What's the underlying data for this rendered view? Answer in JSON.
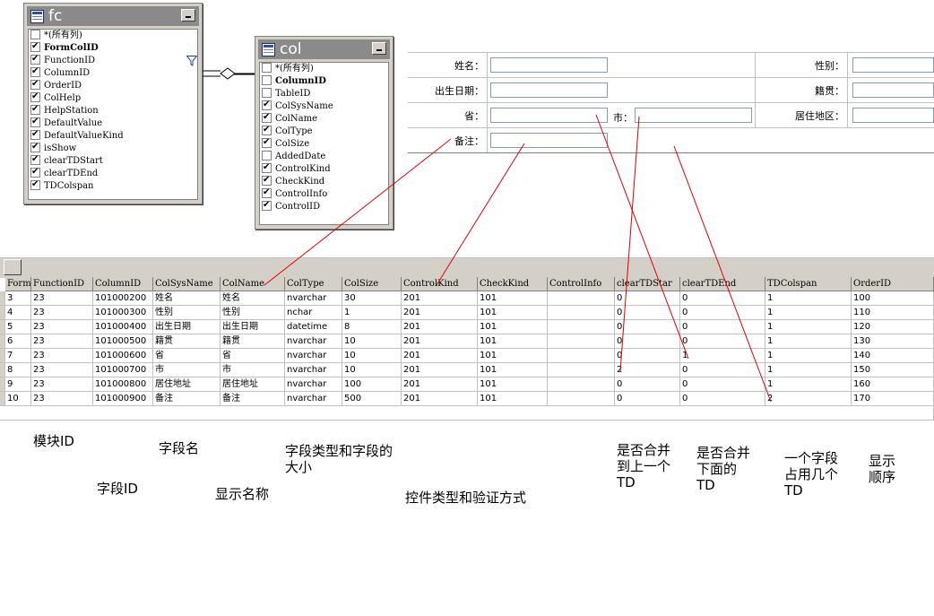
{
  "fc_window": {
    "title": "fc",
    "fields": [
      {
        "label": "*(所有列)",
        "checked": false,
        "bold": false
      },
      {
        "label": "FormColID",
        "checked": true,
        "bold": true
      },
      {
        "label": "FunctionID",
        "checked": true,
        "bold": false
      },
      {
        "label": "ColumnID",
        "checked": true,
        "bold": false
      },
      {
        "label": "OrderID",
        "checked": true,
        "bold": false
      },
      {
        "label": "ColHelp",
        "checked": true,
        "bold": false
      },
      {
        "label": "HelpStation",
        "checked": true,
        "bold": false
      },
      {
        "label": "DefaultValue",
        "checked": true,
        "bold": false
      },
      {
        "label": "DefaultValueKind",
        "checked": true,
        "bold": false
      },
      {
        "label": "isShow",
        "checked": true,
        "bold": false
      },
      {
        "label": "clearTDStart",
        "checked": true,
        "bold": false
      },
      {
        "label": "clearTDEnd",
        "checked": true,
        "bold": false
      },
      {
        "label": "TDColspan",
        "checked": true,
        "bold": false
      }
    ]
  },
  "col_window": {
    "title": "col",
    "fields": [
      {
        "label": "*(所有列)",
        "checked": false,
        "bold": false
      },
      {
        "label": "ColumnID",
        "checked": false,
        "bold": true
      },
      {
        "label": "TableID",
        "checked": false,
        "bold": false
      },
      {
        "label": "ColSysName",
        "checked": true,
        "bold": false
      },
      {
        "label": "ColName",
        "checked": true,
        "bold": false
      },
      {
        "label": "ColType",
        "checked": true,
        "bold": false
      },
      {
        "label": "ColSize",
        "checked": true,
        "bold": false
      },
      {
        "label": "AddedDate",
        "checked": false,
        "bold": false
      },
      {
        "label": "ControlKind",
        "checked": true,
        "bold": false
      },
      {
        "label": "CheckKind",
        "checked": true,
        "bold": false
      },
      {
        "label": "ControlInfo",
        "checked": true,
        "bold": false
      },
      {
        "label": "ControlID",
        "checked": true,
        "bold": false
      }
    ]
  },
  "form": {
    "name_label": "姓名：",
    "gender_label": "性别：",
    "birth_label": "出生日期：",
    "origin_label": "籍贯：",
    "province_label": "省：",
    "city_label": "市：",
    "address_label": "居住地区：",
    "note_label": "备注："
  },
  "grid": {
    "columns": [
      "Form",
      "FunctionID",
      "ColumnID",
      "ColSysName",
      "ColName",
      "ColType",
      "ColSize",
      "ControlKind",
      "CheckKind",
      "ControlInfo",
      "clearTDStar",
      "clearTDEnd",
      "TDColspan",
      "OrderID"
    ],
    "rows": [
      [
        "3",
        "23",
        "101000200",
        "姓名",
        "姓名",
        "nvarchar",
        "30",
        "201",
        "101",
        "",
        "0",
        "0",
        "1",
        "100"
      ],
      [
        "4",
        "23",
        "101000300",
        "性别",
        "性别",
        "nchar",
        "1",
        "201",
        "101",
        "",
        "0",
        "0",
        "1",
        "110"
      ],
      [
        "5",
        "23",
        "101000400",
        "出生日期",
        "出生日期",
        "datetime",
        "8",
        "201",
        "101",
        "",
        "0",
        "0",
        "1",
        "120"
      ],
      [
        "6",
        "23",
        "101000500",
        "籍贯",
        "籍贯",
        "nvarchar",
        "10",
        "201",
        "101",
        "",
        "0",
        "0",
        "1",
        "130"
      ],
      [
        "7",
        "23",
        "101000600",
        "省",
        "省",
        "nvarchar",
        "10",
        "201",
        "101",
        "",
        "0",
        "1",
        "1",
        "140"
      ],
      [
        "8",
        "23",
        "101000700",
        "市",
        "市",
        "nvarchar",
        "10",
        "201",
        "101",
        "",
        "2",
        "0",
        "1",
        "150"
      ],
      [
        "9",
        "23",
        "101000800",
        "居住地址",
        "居住地址",
        "nvarchar",
        "100",
        "201",
        "101",
        "",
        "0",
        "0",
        "1",
        "160"
      ],
      [
        "10",
        "23",
        "101000900",
        "备注",
        "备注",
        "nvarchar",
        "500",
        "201",
        "101",
        "",
        "0",
        "0",
        "2",
        "170"
      ]
    ]
  },
  "annotations": {
    "module_id": "模块ID",
    "field_name": "字段名",
    "field_type": "字段类型和字段的大小",
    "field_id": "字段ID",
    "display_name": "显示名称",
    "control_type": "控件类型和验证方式",
    "merge_prev": "是否合并到上一个TD",
    "merge_next": "是否合并下面的TD",
    "colspan": "一个字段占用几个TD",
    "order": "显示顺序"
  },
  "colors": {
    "annotation_line": "#e00000",
    "input_border": "#7f9db9",
    "chrome": "#d4d0c8"
  }
}
